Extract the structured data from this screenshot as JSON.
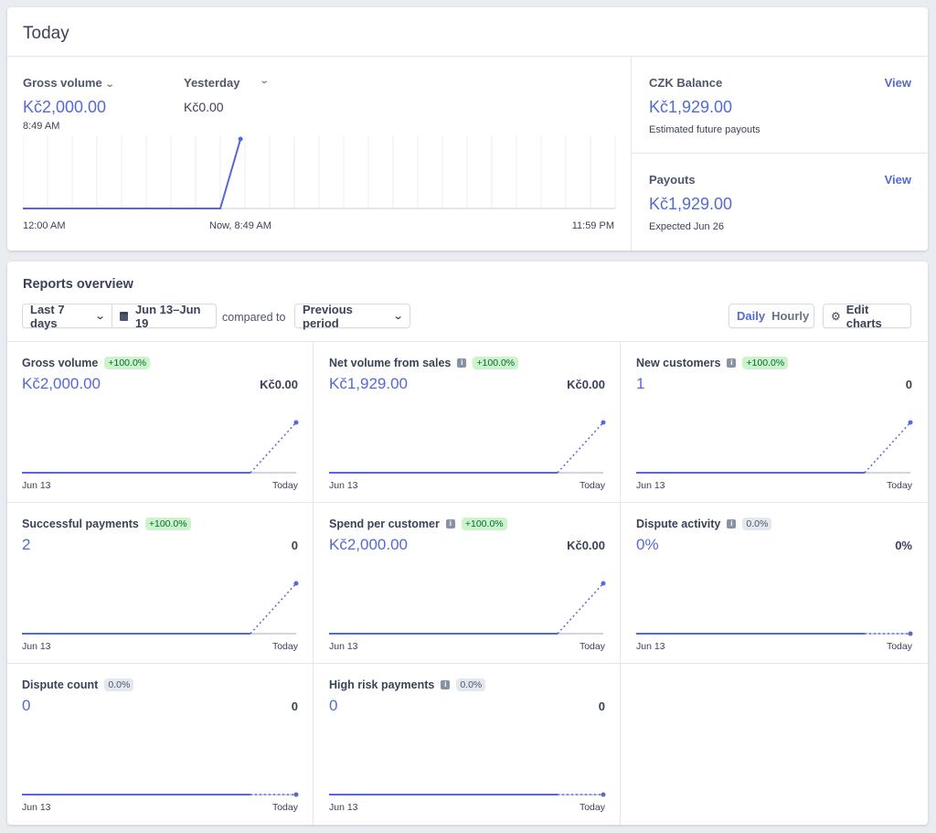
{
  "today": {
    "title": "Today",
    "gross_volume": {
      "label": "Gross volume",
      "value": "Kč2,000.00",
      "time": "8:49 AM"
    },
    "compare": {
      "label": "Yesterday",
      "value": "Kč0.00"
    },
    "chart": {
      "x_start": "12:00 AM",
      "x_now": "Now, 8:49 AM",
      "x_end": "11:59 PM"
    },
    "balance": {
      "label": "CZK Balance",
      "link": "View",
      "value": "Kč1,929.00",
      "note": "Estimated future payouts"
    },
    "payouts": {
      "label": "Payouts",
      "link": "View",
      "value": "Kč1,929.00",
      "note": "Expected Jun 26"
    }
  },
  "reports": {
    "title": "Reports overview",
    "range_select": "Last 7 days",
    "date_range": "Jun 13–Jun 19",
    "compared_to_label": "compared to",
    "compare_select": "Previous period",
    "granularity": {
      "daily": "Daily",
      "hourly": "Hourly",
      "selected": "daily"
    },
    "edit_charts": "Edit charts",
    "metrics": [
      {
        "title": "Gross volume",
        "info": false,
        "badge": "+100.0%",
        "badge_type": "pos",
        "value": "Kč2,000.00",
        "previous": "Kč0.00",
        "x_start": "Jun 13",
        "x_end": "Today",
        "trend": "up"
      },
      {
        "title": "Net volume from sales",
        "info": true,
        "badge": "+100.0%",
        "badge_type": "pos",
        "value": "Kč1,929.00",
        "previous": "Kč0.00",
        "x_start": "Jun 13",
        "x_end": "Today",
        "trend": "up"
      },
      {
        "title": "New customers",
        "info": true,
        "badge": "+100.0%",
        "badge_type": "pos",
        "value": "1",
        "previous": "0",
        "x_start": "Jun 13",
        "x_end": "Today",
        "trend": "up"
      },
      {
        "title": "Successful payments",
        "info": false,
        "badge": "+100.0%",
        "badge_type": "pos",
        "value": "2",
        "previous": "0",
        "x_start": "Jun 13",
        "x_end": "Today",
        "trend": "up"
      },
      {
        "title": "Spend per customer",
        "info": true,
        "badge": "+100.0%",
        "badge_type": "pos",
        "value": "Kč2,000.00",
        "previous": "Kč0.00",
        "x_start": "Jun 13",
        "x_end": "Today",
        "trend": "up"
      },
      {
        "title": "Dispute activity",
        "info": true,
        "badge": "0.0%",
        "badge_type": "neu",
        "value": "0%",
        "previous": "0%",
        "x_start": "Jun 13",
        "x_end": "Today",
        "trend": "flat"
      },
      {
        "title": "Dispute count",
        "info": false,
        "badge": "0.0%",
        "badge_type": "neu",
        "value": "0",
        "previous": "0",
        "x_start": "Jun 13",
        "x_end": "Today",
        "trend": "flat"
      },
      {
        "title": "High risk payments",
        "info": true,
        "badge": "0.0%",
        "badge_type": "neu",
        "value": "0",
        "previous": "0",
        "x_start": "Jun 13",
        "x_end": "Today",
        "trend": "flat"
      }
    ]
  },
  "colors": {
    "accent": "#5469d4",
    "badge_positive_bg": "#cbf4c9",
    "badge_positive_text": "#0e6245",
    "badge_neutral_bg": "#e3e8ee"
  },
  "chart_data": {
    "type": "line",
    "title": "Gross volume (Today)",
    "xlabel": "",
    "ylabel": "",
    "x_ticks": [
      "12:00 AM",
      "Now, 8:49 AM",
      "11:59 PM"
    ],
    "x_range_hours": [
      0,
      24
    ],
    "series": [
      {
        "name": "Today",
        "x_hours": [
          0,
          8,
          8.82
        ],
        "values": [
          0,
          0,
          2000
        ]
      }
    ],
    "grid": "vertical hourly",
    "ylim": [
      0,
      2000
    ]
  }
}
